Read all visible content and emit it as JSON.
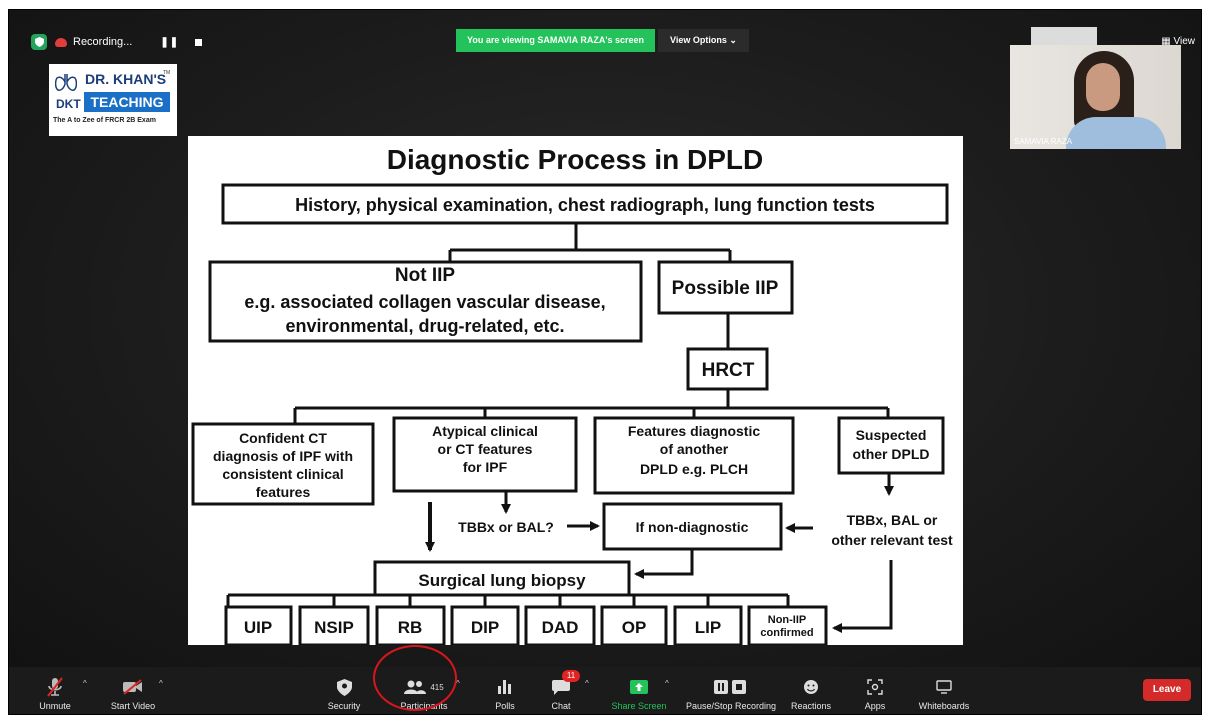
{
  "status": {
    "recording_label": "Recording..."
  },
  "banner": {
    "viewing_text": "You are viewing SAMAVIA RAZA's screen",
    "view_options": "View Options ⌄",
    "view_label": "View"
  },
  "participant": {
    "name": "SAMAVIA RAZA"
  },
  "logo": {
    "line1": "DR. KHAN'S",
    "tm": "TM",
    "dkt": "DKT",
    "teaching": "TEACHING",
    "tagline": "The A to Zee of FRCR 2B Exam"
  },
  "slide": {
    "title": "Diagnostic Process in DPLD",
    "history": "History, physical examination, chest radiograph, lung function tests",
    "not_iip": {
      "line1": "Not IIP",
      "line2": "e.g. associated collagen vascular disease,",
      "line3": "environmental, drug-related, etc."
    },
    "possible_iip": "Possible IIP",
    "hrct": "HRCT",
    "confident": [
      "Confident CT",
      "diagnosis of IPF with",
      "consistent clinical",
      "features"
    ],
    "atypical": [
      "Atypical clinical",
      "or CT features",
      "for IPF"
    ],
    "features_diag": [
      "Features diagnostic",
      "of another",
      "DPLD e.g. PLCH"
    ],
    "suspected": [
      "Suspected",
      "other DPLD"
    ],
    "tbbx_bal": "TBBx or BAL?",
    "non_diagnostic": "If non-diagnostic",
    "tbbx_other": [
      "TBBx, BAL or",
      "other relevant test"
    ],
    "surgical": "Surgical lung biopsy",
    "outcomes": [
      "UIP",
      "NSIP",
      "RB",
      "DIP",
      "DAD",
      "OP",
      "LIP"
    ],
    "non_iip": [
      "Non-IIP",
      "confirmed"
    ]
  },
  "toolbar": {
    "unmute": "Unmute",
    "start_video": "Start Video",
    "security": "Security",
    "participants": "Participants",
    "participant_count": "415",
    "polls": "Polls",
    "chat": "Chat",
    "chat_badge": "11",
    "share_screen": "Share Screen",
    "pause_recording": "Pause/Stop Recording",
    "reactions": "Reactions",
    "apps": "Apps",
    "whiteboards": "Whiteboards",
    "leave": "Leave"
  },
  "colors": {
    "accent_green": "#23c25a",
    "leave_red": "#d42a2a",
    "badge_red": "#e02424",
    "annotation_red": "#d8161e"
  }
}
